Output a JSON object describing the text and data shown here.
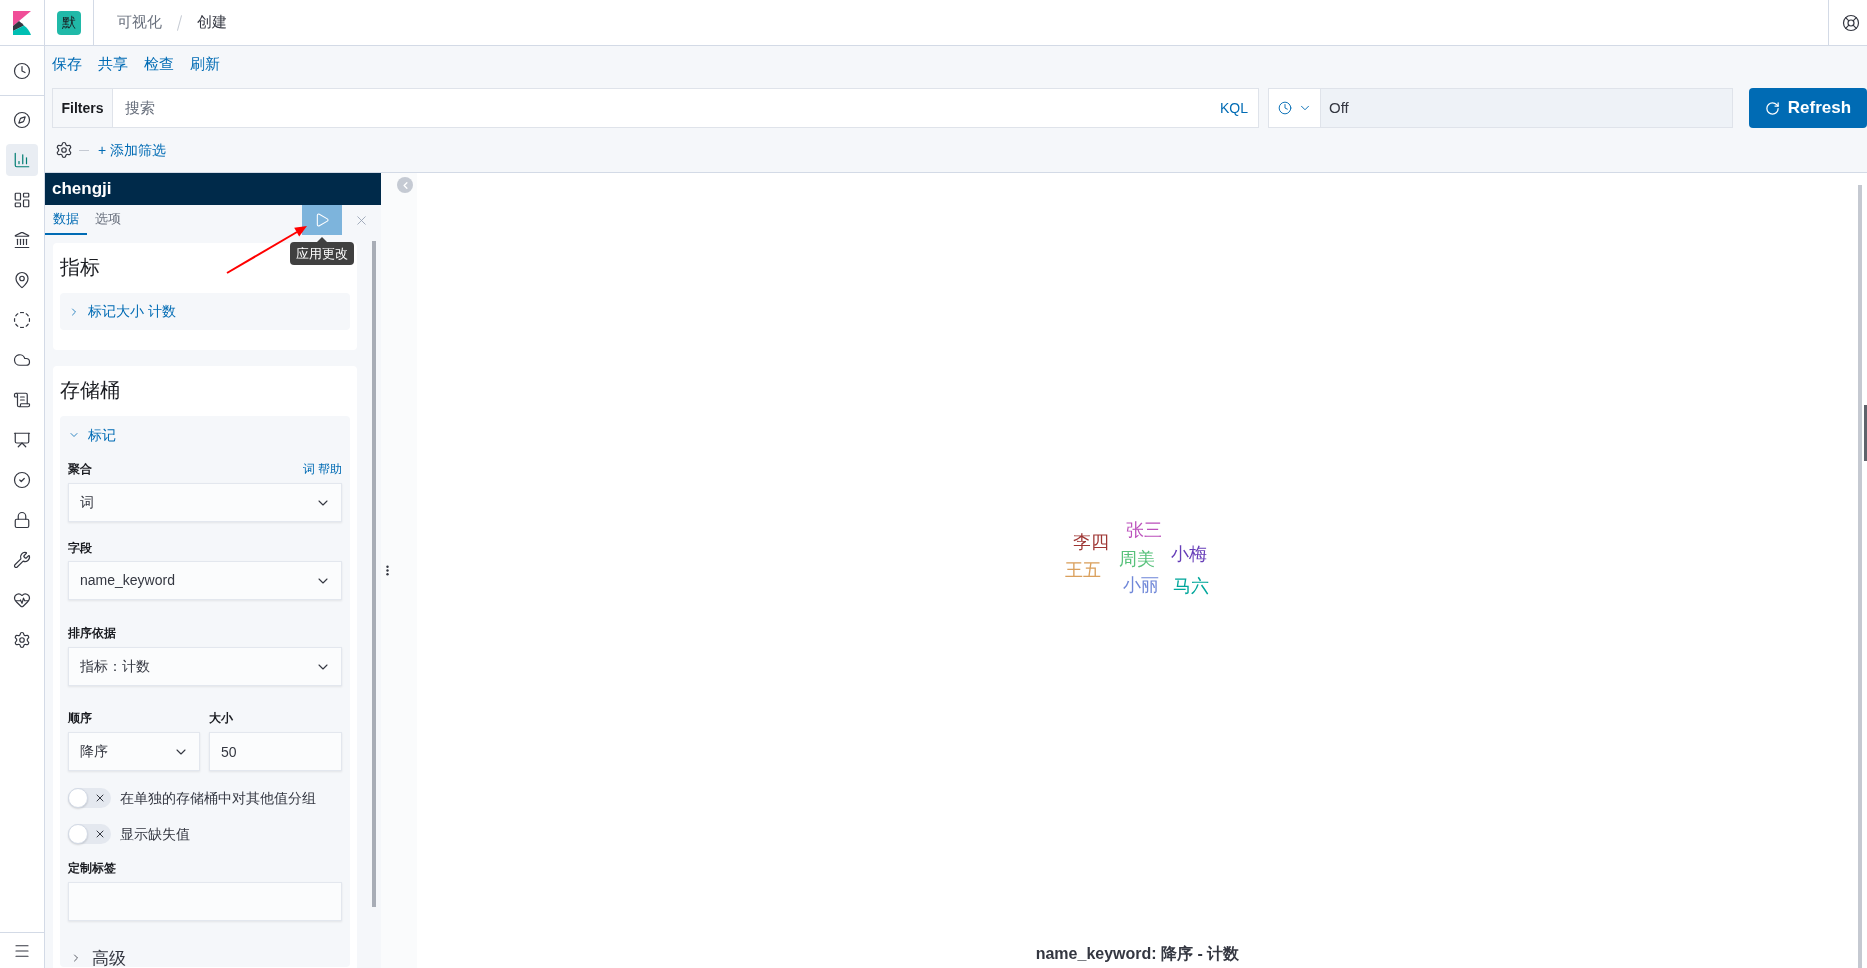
{
  "header": {
    "space_avatar": "默",
    "breadcrumbs": [
      {
        "label": "可视化",
        "current": false
      },
      {
        "label": "创建",
        "current": true
      }
    ]
  },
  "nav_rail": {
    "items": [
      {
        "selected": false
      },
      {
        "selected": false
      },
      {
        "selected": true
      },
      {
        "selected": false
      },
      {
        "selected": false
      },
      {
        "selected": false
      },
      {
        "selected": false
      },
      {
        "selected": false
      },
      {
        "selected": false
      },
      {
        "selected": false
      },
      {
        "selected": false
      },
      {
        "selected": false
      },
      {
        "selected": false
      },
      {
        "selected": false
      },
      {
        "selected": false
      }
    ]
  },
  "top_menu": [
    "保存",
    "共享",
    "检查",
    "刷新"
  ],
  "query_bar": {
    "filters_label": "Filters",
    "placeholder": "搜索",
    "language": "KQL",
    "refresh_interval": "Off",
    "refresh_button": "Refresh"
  },
  "add_filter": "+ 添加筛选",
  "editor": {
    "title": "chengji",
    "tabs": [
      {
        "label": "数据",
        "selected": true
      },
      {
        "label": "选项",
        "selected": false
      }
    ],
    "apply_tooltip": "应用更改",
    "metrics": {
      "title": "指标",
      "items": [
        {
          "label": "标记大小 计数",
          "expanded": false
        }
      ]
    },
    "buckets": {
      "title": "存储桶",
      "items": [
        {
          "label": "标记",
          "expanded": true,
          "aggregation": {
            "label": "聚合",
            "help": "词 帮助",
            "value": "词"
          },
          "field": {
            "label": "字段",
            "value": "name_keyword"
          },
          "order_by": {
            "label": "排序依据",
            "value": "指标：计数"
          },
          "order": {
            "label": "顺序",
            "value": "降序"
          },
          "size": {
            "label": "大小",
            "value": "50"
          },
          "switches": [
            {
              "label": "在单独的存储桶中对其他值分组",
              "on": false
            },
            {
              "label": "显示缺失值",
              "on": false
            }
          ],
          "custom_label": {
            "label": "定制标签"
          },
          "advanced": {
            "label": "高级",
            "expanded": false
          }
        }
      ]
    }
  },
  "word_cloud": {
    "words": [
      {
        "text": "张三",
        "color": "#bc52bc"
      },
      {
        "text": "李四",
        "color": "#9e3533"
      },
      {
        "text": "小梅",
        "color": "#663db8"
      },
      {
        "text": "周美",
        "color": "#57c17b"
      },
      {
        "text": "王五",
        "color": "#daa05d"
      },
      {
        "text": "小丽",
        "color": "#6f87d8"
      },
      {
        "text": "马六",
        "color": "#00a69b"
      }
    ],
    "caption": "name_keyword: 降序 - 计数"
  }
}
